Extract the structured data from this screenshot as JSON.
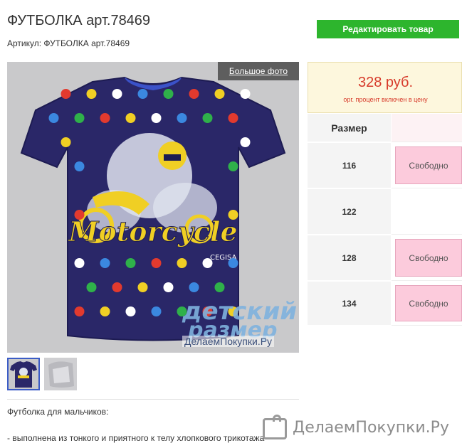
{
  "product": {
    "title": "ФУТБОЛКА арт.78469",
    "sku_line": "Артикул: ФУТБОЛКА арт.78469",
    "edit_label": "Редактировать товар",
    "big_photo_label": "Большое фото",
    "shirt_print_text": "Motorcycle",
    "shirt_brand_text": "CEGISA"
  },
  "watermark": {
    "line1": "детский",
    "line2": "размер",
    "line3": "ДелаемПокупки.Ру"
  },
  "price": {
    "value": "328 руб.",
    "note": "орг. процент включен в цену"
  },
  "sizes": {
    "header": "Размер",
    "rows": [
      {
        "size": "116",
        "status": "Свободно"
      },
      {
        "size": "122",
        "status": ""
      },
      {
        "size": "128",
        "status": "Свободно"
      },
      {
        "size": "134",
        "status": "Свободно"
      }
    ]
  },
  "description": {
    "line1": "Футболка для мальчиков:",
    "line2": "- выполнена из тонкого и приятного к телу хлопкового трикотажа"
  },
  "footer_logo": {
    "text": "ДелаемПокупки.Ру",
    "icon": "shopping-bag-icon"
  },
  "colors": {
    "accent_green": "#2db52d",
    "price_red": "#d73a2a",
    "free_pink": "#fccbdc",
    "shirt_navy": "#2a2768"
  }
}
